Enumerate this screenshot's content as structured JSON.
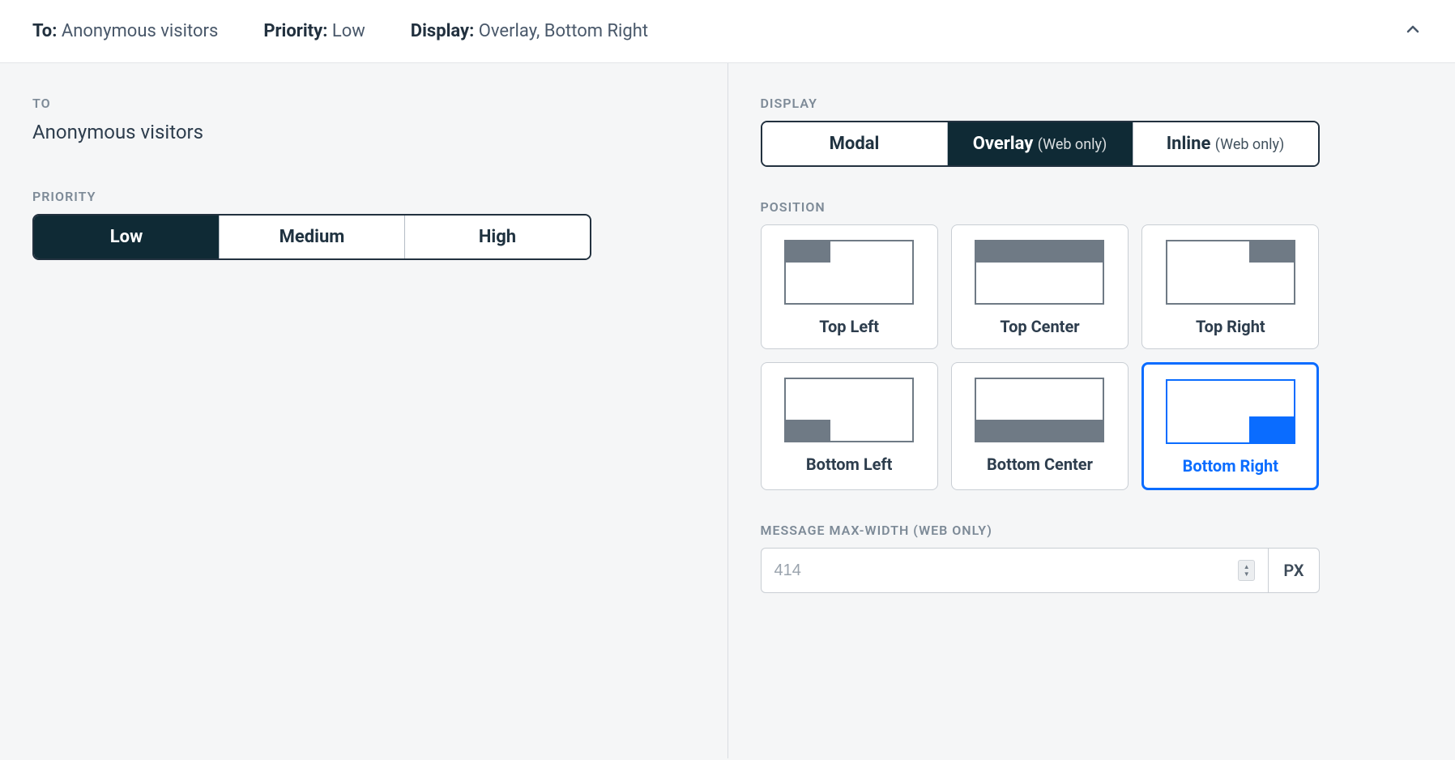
{
  "summary": {
    "to_label": "To:",
    "to_value": "Anonymous visitors",
    "priority_label": "Priority:",
    "priority_value": "Low",
    "display_label": "Display:",
    "display_value": "Overlay, Bottom Right"
  },
  "left": {
    "to_heading": "TO",
    "to_value": "Anonymous visitors",
    "priority_heading": "PRIORITY",
    "priority_options": {
      "low": "Low",
      "medium": "Medium",
      "high": "High"
    }
  },
  "right": {
    "display_heading": "DISPLAY",
    "display_options": {
      "modal": "Modal",
      "overlay": "Overlay",
      "overlay_suffix": "(Web only)",
      "inline": "Inline",
      "inline_suffix": "(Web only)"
    },
    "position_heading": "POSITION",
    "positions": {
      "tl": "Top Left",
      "tc": "Top Center",
      "tr": "Top Right",
      "bl": "Bottom Left",
      "bc": "Bottom Center",
      "br": "Bottom Right"
    },
    "maxwidth_heading": "MESSAGE MAX-WIDTH (WEB ONLY)",
    "maxwidth_placeholder": "414",
    "maxwidth_unit": "PX"
  }
}
